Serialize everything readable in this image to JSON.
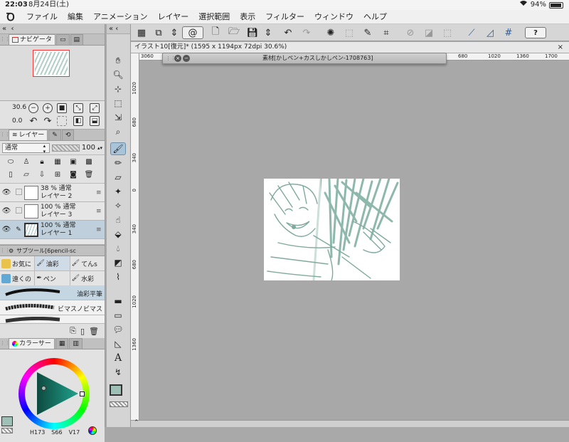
{
  "status": {
    "time": "22:03",
    "date": "8月24日(土)",
    "battery": "94%"
  },
  "menu": [
    "ファイル",
    "編集",
    "アニメーション",
    "レイヤー",
    "選択範囲",
    "表示",
    "フィルター",
    "ウィンドウ",
    "ヘルプ"
  ],
  "navigator": {
    "tab_label": "ナビゲータ",
    "zoom": "30.6",
    "rotate": "0.0"
  },
  "layers": {
    "tab_label": "レイヤー",
    "blend_mode": "通常",
    "opacity": "100",
    "rows": [
      {
        "opacity_mode": "38 % 通常",
        "name": "レイヤー 2"
      },
      {
        "opacity_mode": "100 % 通常",
        "name": "レイヤー 3"
      },
      {
        "opacity_mode": "100 % 通常",
        "name": "レイヤー 1"
      }
    ]
  },
  "subtool": {
    "title": "サブツール[6pencil-sc",
    "groups": [
      "お気に",
      "油彩",
      "てんs",
      "遠くの",
      "ペン",
      "水彩"
    ],
    "brushes": [
      "油彩平筆",
      "ビマスノビマス"
    ]
  },
  "color": {
    "tab_label": "カラーサー",
    "h": "173",
    "s": "66",
    "v": "17",
    "main_color": "#9dbfb5"
  },
  "document": {
    "tab": "イラスト10[復元]* (1595 x 1194px 72dpi 30.6%)"
  },
  "material_panel": {
    "title": "素材[かしペン+カスしかしペン-1708763]"
  },
  "ruler_h": [
    "3060",
    "680",
    "1020",
    "1360",
    "1700"
  ],
  "ruler_v": [
    "1020",
    "680",
    "340",
    "0",
    "340",
    "680",
    "1020",
    "1360"
  ]
}
